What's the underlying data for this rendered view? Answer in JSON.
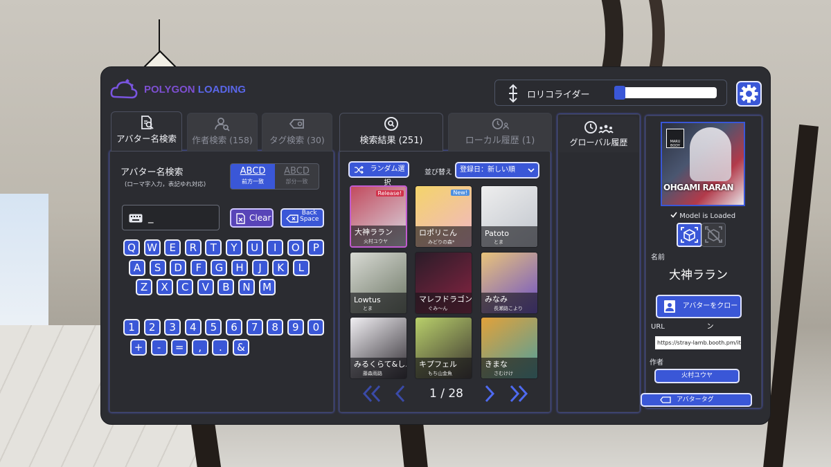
{
  "app": {
    "logo_prefix": "POLYGON",
    "logo_suffix": " LOADING"
  },
  "header": {
    "height_label": "ロリコライダー",
    "slider_value": 0.06
  },
  "left_tabs": [
    {
      "label": "アバター名検索"
    },
    {
      "label": "作者検索 (158)"
    },
    {
      "label": "タグ検索 (30)"
    }
  ],
  "search": {
    "title": "アバター名検索",
    "subtitle": "(ローマ字入力，表記ゆれ対応)",
    "mode_sample": "ABCD",
    "mode_prefix": "前方一致",
    "mode_partial": "部分一致",
    "input_value": "_",
    "clear_label": "Clear",
    "backspace_label": "Back\nSpace"
  },
  "keyboard": {
    "row1": [
      "Q",
      "W",
      "E",
      "R",
      "T",
      "Y",
      "U",
      "I",
      "O",
      "P"
    ],
    "row2": [
      "A",
      "S",
      "D",
      "F",
      "G",
      "H",
      "J",
      "K",
      "L"
    ],
    "row3": [
      "Z",
      "X",
      "C",
      "V",
      "B",
      "N",
      "M"
    ],
    "row4": [
      "1",
      "2",
      "3",
      "4",
      "5",
      "6",
      "7",
      "8",
      "9",
      "0"
    ],
    "row5": [
      "+",
      "-",
      "=",
      ",",
      ".",
      "&"
    ]
  },
  "mid_tabs": [
    {
      "label": "検索結果 (251)"
    },
    {
      "label": "ローカル履歴 (1)"
    }
  ],
  "results": {
    "random_label": "ランダム選択",
    "sort_label": "並び替え",
    "sort_value": "登録日：新しい順",
    "items": [
      {
        "name": "大神ララン",
        "author": "火村ユウヤ",
        "badge": "Release!",
        "c1": "#c24b5e",
        "c2": "#d9d9e3"
      },
      {
        "name": "ロポリこん",
        "author": "みどりの森*",
        "badge": "New!",
        "c1": "#f3d46a",
        "c2": "#f2b6c6"
      },
      {
        "name": "Patoto",
        "author": "とま",
        "badge": "",
        "c1": "#eeeeee",
        "c2": "#bfc4cc"
      },
      {
        "name": "Lowtus",
        "author": "とま",
        "badge": "",
        "c1": "#d8dad4",
        "c2": "#6b7563"
      },
      {
        "name": "マレフドラゴン",
        "author": "ぐみ～ん",
        "badge": "",
        "c1": "#2a1c28",
        "c2": "#8a2443"
      },
      {
        "name": "みなみ",
        "author": "長瀬路こより",
        "badge": "",
        "c1": "#e9c47a",
        "c2": "#6a4fc9"
      },
      {
        "name": "みるくらて&し...",
        "author": "藤森雨路",
        "badge": "",
        "c1": "#f1eff3",
        "c2": "#2e2a30"
      },
      {
        "name": "キプフェル",
        "author": "もち山金魚",
        "badge": "",
        "c1": "#b9d06b",
        "c2": "#3a3330"
      },
      {
        "name": "きまな",
        "author": "さむけけ",
        "badge": "",
        "c1": "#e2a13a",
        "c2": "#4ca0a0"
      }
    ],
    "page_label": "1 / 28"
  },
  "global_tab": {
    "label": "グローバル履歴"
  },
  "detail": {
    "loaded_label": "Model is Loaded",
    "name_heading": "名前",
    "name": "大神ララン",
    "clone_label": "アバターをクローン",
    "url_heading": "URL",
    "url": "https://stray-lamb.booth.pm/ite",
    "author_heading": "作者",
    "author": "火村ユウヤ",
    "tag_label": "アバタータグ",
    "art_badge": "MARU BODY",
    "art_title": "OHGAMI RARAN"
  },
  "colors": {
    "accent": "#3a57d7",
    "outline": "#5e6dff",
    "panel": "#2c2d32"
  }
}
